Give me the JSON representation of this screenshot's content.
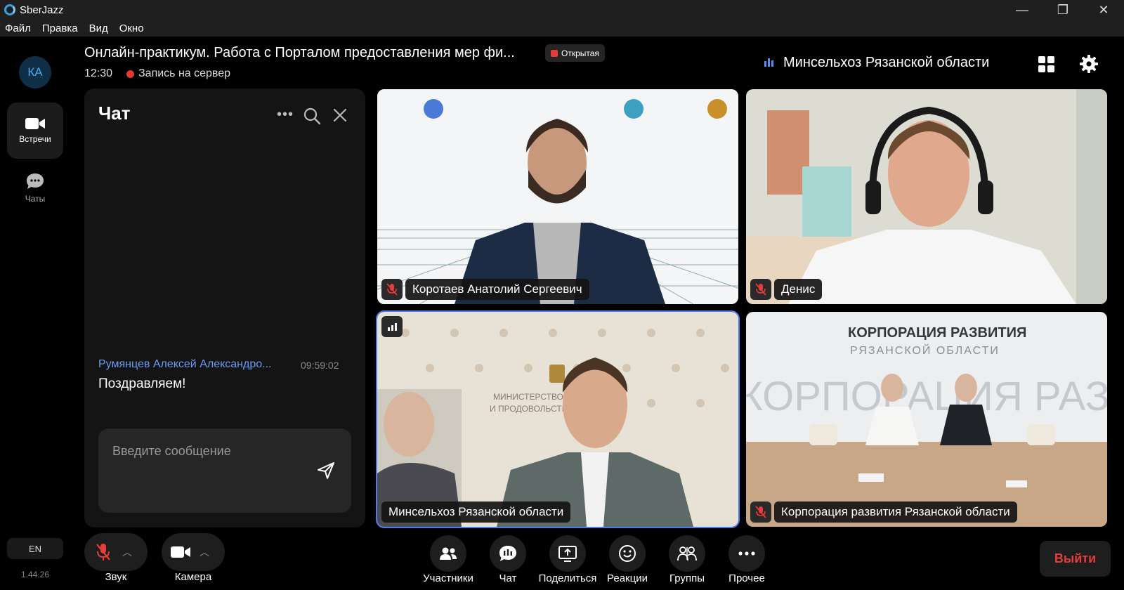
{
  "window": {
    "title": "SberJazz",
    "minimize": "—",
    "maximize": "❐",
    "close": "✕"
  },
  "menu": [
    "Файл",
    "Правка",
    "Вид",
    "Окно"
  ],
  "sidebar": {
    "avatar": "КА",
    "items": [
      {
        "label": "Встречи",
        "icon": "video-camera-icon"
      },
      {
        "label": "Чаты",
        "icon": "chat-bubble-icon"
      }
    ],
    "lang": "EN",
    "version": "1.44.26"
  },
  "meeting": {
    "title": "Онлайн-практикум. Работа с Порталом предоставления мер фи...",
    "badge": "Открытая",
    "time": "12:30",
    "recording": "Запись на сервер",
    "speaker": "Минсельхоз Рязанской области"
  },
  "chat": {
    "title": "Чат",
    "more": "•••",
    "messages": [
      {
        "author": "Румянцев Алексей Александро...",
        "time": "09:59:02",
        "text": "Поздравляем!"
      }
    ],
    "input_placeholder": "Введите сообщение"
  },
  "participants": [
    {
      "name": "Коротаев Анатолий Сергеевич",
      "muted": true
    },
    {
      "name": "Денис",
      "muted": true
    },
    {
      "name": "Минсельхоз Рязанской области",
      "muted": false,
      "active": true
    },
    {
      "name": "Корпорация развития Рязанской области",
      "muted": true
    }
  ],
  "backdrop": {
    "banner_line1": "КОРПОРАЦИЯ РАЗВИТИЯ",
    "banner_line2": "РЯЗАНСКОЙ ОБЛАСТИ",
    "wall_big": "КОРПОРАЦИЯ РАЗВИТИЯ",
    "ministry_line1": "МИНИСТЕРСТВО СЕЛЬСК",
    "ministry_line2": "И ПРОДОВОЛЬСТВИЯ РЯЗАН"
  },
  "controls": {
    "sound": "Звук",
    "camera": "Камера"
  },
  "toolbar": [
    "Участники",
    "Чат",
    "Поделиться",
    "Реакции",
    "Группы",
    "Прочее"
  ],
  "exit": "Выйти",
  "colors": {
    "accent": "#5b8cf2",
    "danger": "#e53c3c",
    "panel": "#141414"
  }
}
